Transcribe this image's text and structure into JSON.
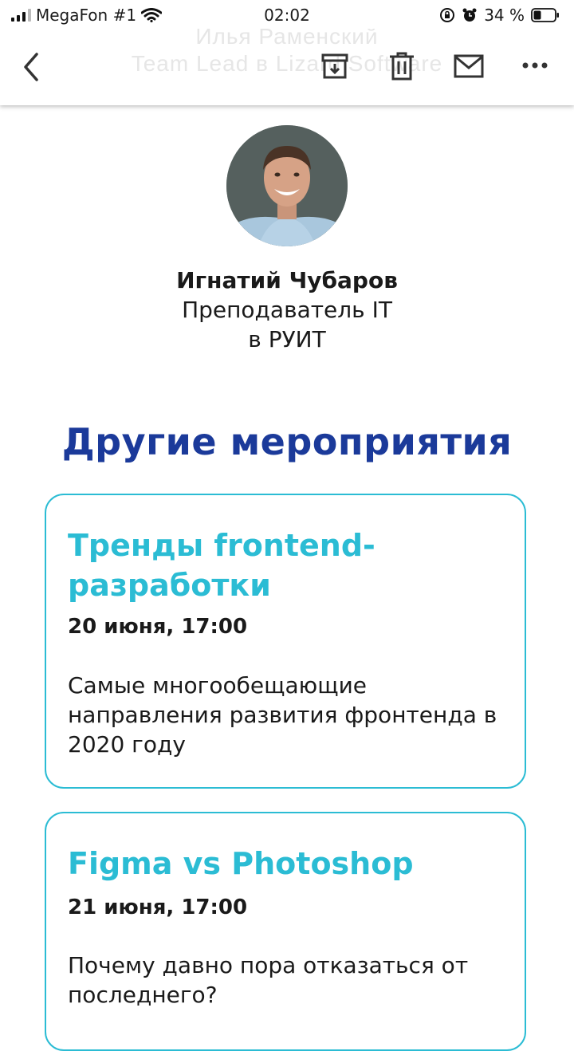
{
  "status_bar": {
    "carrier": "MegaFon #1",
    "time": "02:02",
    "battery": "34 %",
    "icons": [
      "signal-icon",
      "wifi-icon",
      "lock-rotation-icon",
      "alarm-icon",
      "battery-icon"
    ]
  },
  "header": {
    "background_name": "Илья Раменский",
    "background_title": "Team Lead в Lizard Software",
    "icons": [
      "back-icon",
      "archive-icon",
      "trash-icon",
      "mail-icon",
      "more-icon"
    ]
  },
  "speaker": {
    "name": "Игнатий Чубаров",
    "role": "Преподаватель IT",
    "place": "в РУИТ"
  },
  "section_title": "Другие мероприятия",
  "events": [
    {
      "title": "Тренды frontend-разработки",
      "date": "20 июня, 17:00",
      "description": "Самые многообещающие направления развития фронтенда в 2020 году"
    },
    {
      "title": "Figma vs Photoshop",
      "date": "21 июня, 17:00",
      "description": "Почему давно пора отказаться от последнего?"
    }
  ],
  "colors": {
    "accent": "#2bbcd4",
    "heading": "#1b3a9a",
    "text": "#1a1a1a"
  }
}
